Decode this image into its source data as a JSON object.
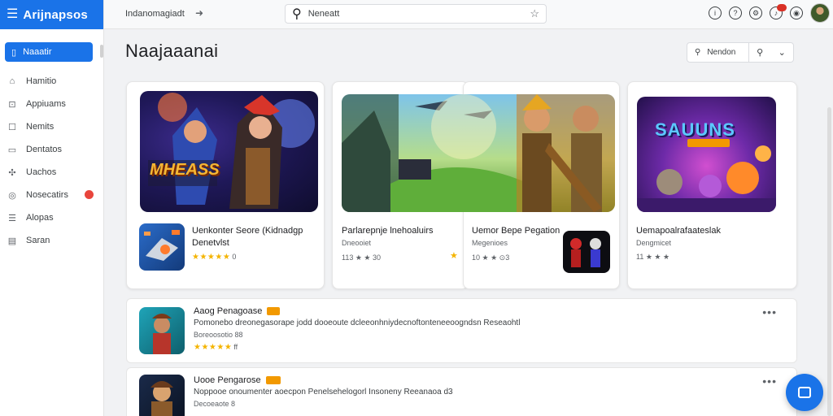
{
  "app": {
    "name": "Arijnapsos"
  },
  "sidebar": {
    "primary_label": "Naaatir",
    "items": [
      {
        "label": "Hamitio",
        "icon": "home-icon",
        "badge": false
      },
      {
        "label": "Appiuams",
        "icon": "apps-icon",
        "badge": false
      },
      {
        "label": "Nemits",
        "icon": "square-icon",
        "badge": false
      },
      {
        "label": "Dentatos",
        "icon": "folder-icon",
        "badge": false
      },
      {
        "label": "Uachos",
        "icon": "puzzle-icon",
        "badge": false
      },
      {
        "label": "Nosecatirs",
        "icon": "shield-icon",
        "badge": true
      },
      {
        "label": "Alopas",
        "icon": "list-icon",
        "badge": false
      },
      {
        "label": "Saran",
        "icon": "document-icon",
        "badge": false
      }
    ]
  },
  "topbar": {
    "breadcrumb": "Indanomagiadt",
    "search_value": "Neneatt"
  },
  "main": {
    "title": "Naajaaanai",
    "search_button_label": "Nendon"
  },
  "featured": [
    {
      "title_line1": "Uenkonter Seore (Kidnadgp",
      "title_line2": "Denetvlst",
      "subtitle": "",
      "rating_text": "0",
      "banner_text": "MHEASS"
    },
    {
      "title_line1": "Parlarepnje lnehoaluirs",
      "title_line2": "",
      "subtitle": "Dneooiet",
      "rating_text": "113 ★ ★ 30"
    },
    {
      "title_line1": "Uemor Bepe Pegation",
      "title_line2": "",
      "subtitle": "Megenioes",
      "rating_text": "10 ★ ★ ⊙3"
    },
    {
      "title_line1": "Uemapoalrafaateslak",
      "title_line2": "",
      "subtitle": "Dengmicet",
      "rating_text": "11 ★ ★ ★",
      "banner_text": "SAUUNS"
    }
  ],
  "list": [
    {
      "title": "Aaog Penagoase",
      "description": "Pomonebo dreonegasorape jodd dooeoute dcleeonhniydecnoftonteneeoogndsn Reseaohtl",
      "meta": "Boreoosotio 88",
      "rating_text": "ff"
    },
    {
      "title": "Uooe Pengarose",
      "description": "Noppooe onoumenter aoecpon Penelsehelogorl Insoneny Reeanaoa d3",
      "meta": "Decoeaote 8",
      "rating_text": ""
    }
  ]
}
